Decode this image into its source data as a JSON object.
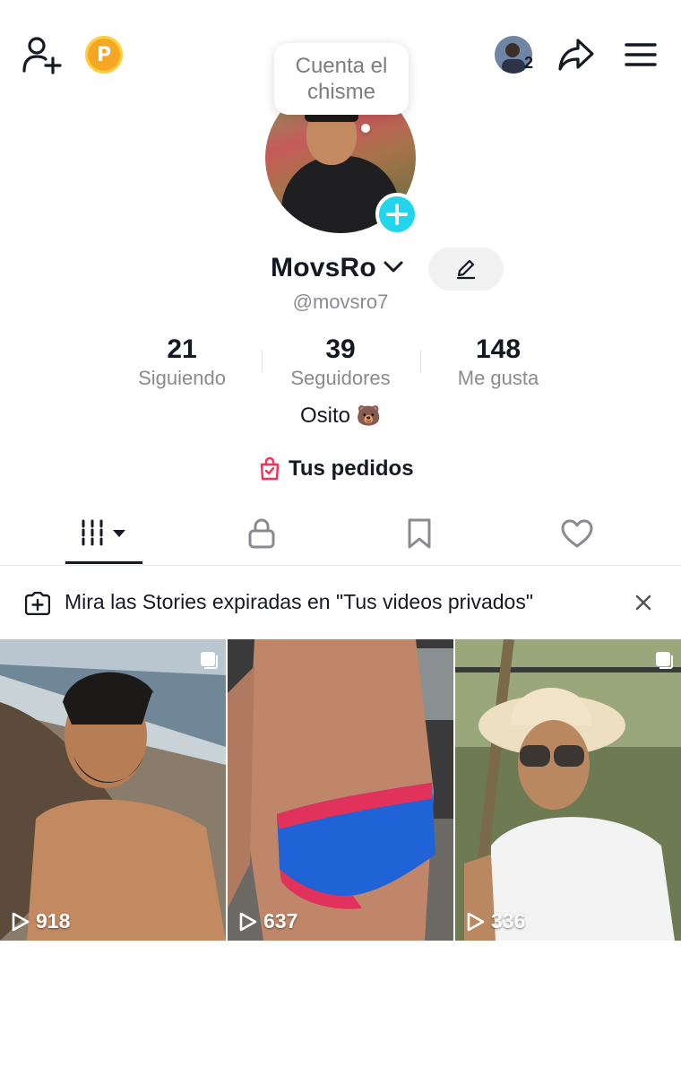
{
  "header": {
    "coin_letter": "P",
    "notification_count": "2"
  },
  "profile": {
    "bubble_text": "Cuenta el chisme",
    "name": "MovsRo",
    "handle": "@movsro7",
    "bio": "Osito",
    "bio_emoji": "🐻",
    "orders_label": "Tus pedidos"
  },
  "stats": [
    {
      "value": "21",
      "label": "Siguiendo"
    },
    {
      "value": "39",
      "label": "Seguidores"
    },
    {
      "value": "148",
      "label": "Me gusta"
    }
  ],
  "tabs": [
    {
      "icon": "grid-icon"
    },
    {
      "icon": "lock-icon"
    },
    {
      "icon": "bookmark-icon"
    },
    {
      "icon": "heart-icon"
    }
  ],
  "banner": {
    "text": "Mira las Stories expiradas en \"Tus videos privados\""
  },
  "videos": [
    {
      "views": "918"
    },
    {
      "views": "637"
    },
    {
      "views": "336"
    }
  ],
  "colors": {
    "accent": "#20d5ec",
    "coin": "#f5a623",
    "orders_icon": "#fe2c55"
  }
}
